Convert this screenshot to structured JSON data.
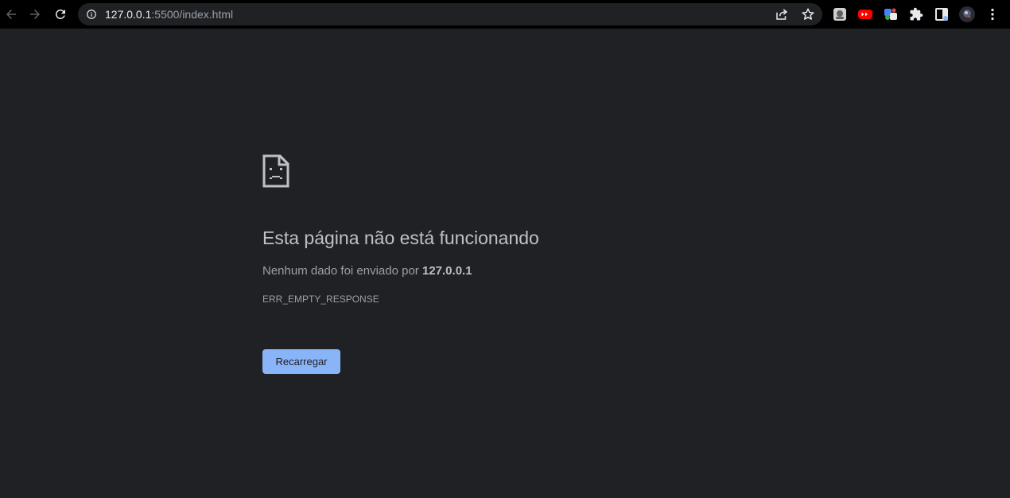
{
  "browser": {
    "url_host": "127.0.0.1",
    "url_rest": ":5500/index.html",
    "nav": {
      "back": "back-arrow-icon",
      "forward": "forward-arrow-icon",
      "reload": "reload-icon"
    },
    "omnibox_icons": [
      "info-icon",
      "share-icon",
      "star-icon"
    ],
    "extensions": [
      "extension-generic-icon",
      "youtube-extension-icon",
      "extension-multicolor-icon",
      "puzzle-icon",
      "side-panel-icon",
      "profile-avatar",
      "more-menu-icon"
    ],
    "colors": {
      "toolbar_bg": "#000000",
      "omnibox_bg": "#202124",
      "page_bg": "#202124",
      "accent": "#8ab4f8",
      "youtube_red": "#ff0000"
    }
  },
  "error_page": {
    "title": "Esta página não está funcionando",
    "message_prefix": "Nenhum dado foi enviado por ",
    "message_host": "127.0.0.1",
    "error_code": "ERR_EMPTY_RESPONSE",
    "reload_label": "Recarregar",
    "icon": "sad-page-icon"
  }
}
